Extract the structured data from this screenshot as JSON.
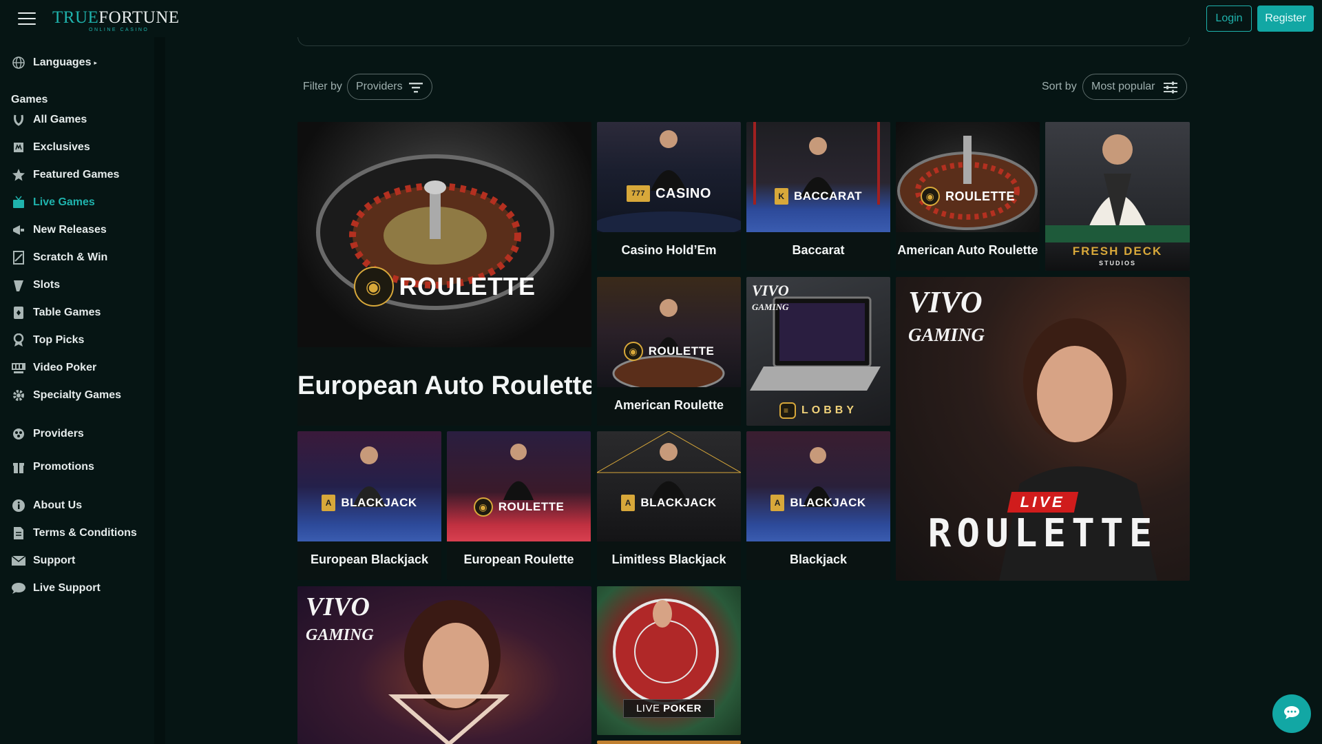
{
  "header": {
    "logo_part1": "TRUE",
    "logo_part2": "FORTUNE",
    "logo_sub": "ONLINE CASINO",
    "login_label": "Login",
    "register_label": "Register"
  },
  "sidebar": {
    "languages_label": "Languages",
    "games_heading": "Games",
    "items": [
      {
        "label": "All Games",
        "icon": "horseshoe-icon"
      },
      {
        "label": "Exclusives",
        "icon": "exclusive-icon"
      },
      {
        "label": "Featured Games",
        "icon": "star-icon"
      },
      {
        "label": "Live Games",
        "icon": "live-tv-icon"
      },
      {
        "label": "New Releases",
        "icon": "megaphone-icon"
      },
      {
        "label": "Scratch & Win",
        "icon": "scratch-card-icon"
      },
      {
        "label": "Slots",
        "icon": "slot-lever-icon"
      },
      {
        "label": "Table Games",
        "icon": "card-table-icon"
      },
      {
        "label": "Top Picks",
        "icon": "award-icon"
      },
      {
        "label": "Video Poker",
        "icon": "video-poker-icon"
      },
      {
        "label": "Specialty Games",
        "icon": "gear-icon"
      }
    ],
    "providers_label": "Providers",
    "promotions_label": "Promotions",
    "info_items": [
      {
        "label": "About Us",
        "icon": "info-icon"
      },
      {
        "label": "Terms & Conditions",
        "icon": "document-icon"
      },
      {
        "label": "Support",
        "icon": "mail-icon"
      },
      {
        "label": "Live Support",
        "icon": "chat-icon"
      }
    ],
    "active_item": "Live Games"
  },
  "toolbar": {
    "filter_label": "Filter by",
    "filter_value": "Providers",
    "sort_label": "Sort by",
    "sort_value": "Most popular"
  },
  "tiles": {
    "european_auto_roulette": {
      "title": "European Auto Roulette",
      "badge": "ROULETTE"
    },
    "casino_holdem": {
      "title": "Casino Hold’Em",
      "badge": "CASINO"
    },
    "baccarat": {
      "title": "Baccarat",
      "badge": "BACCARAT"
    },
    "american_auto_roulette": {
      "title": "American Auto Roulette",
      "badge": "ROULETTE"
    },
    "fresh_deck": {
      "badge": "FRESH DECK",
      "sub": "STUDIOS"
    },
    "american_roulette": {
      "title": "American Roulette",
      "badge": "ROULETTE"
    },
    "vivo_lobby": {
      "brand_1": "VIVO",
      "brand_2": "GAMING",
      "badge": "LOBBY"
    },
    "vivo_live_roulette": {
      "brand_1": "VIVO",
      "brand_2": "GAMING",
      "badge_top": "LIVE",
      "badge": "ROULETTE"
    },
    "european_blackjack": {
      "title": "European Blackjack",
      "badge": "BLACKJACK"
    },
    "european_roulette": {
      "title": "European Roulette",
      "badge": "ROULETTE"
    },
    "limitless_blackjack": {
      "title": "Limitless Blackjack",
      "badge": "BLACKJACK"
    },
    "blackjack": {
      "title": "Blackjack",
      "badge": "BLACKJACK"
    },
    "vivo_promo": {
      "brand_1": "VIVO",
      "brand_2": "GAMING"
    },
    "live_poker": {
      "badge_1": "LIVE",
      "badge_2": "POKER"
    }
  },
  "colors": {
    "accent": "#12a7a4",
    "background": "#061514",
    "gold": "#d8a83a"
  }
}
